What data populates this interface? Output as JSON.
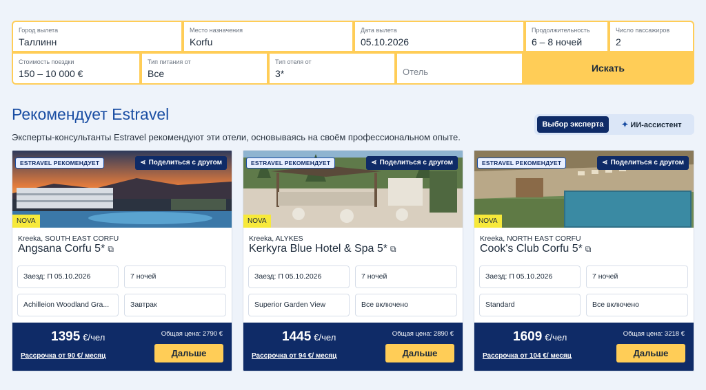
{
  "search": {
    "departure": {
      "label": "Город вылета",
      "value": "Таллинн"
    },
    "destination": {
      "label": "Место назначения",
      "value": "Korfu"
    },
    "date": {
      "label": "Дата вылета",
      "value": "05.10.2026"
    },
    "duration": {
      "label": "Продолжительность",
      "value": "6 – 8 ночей"
    },
    "passengers": {
      "label": "Число пассажиров",
      "value": "2"
    },
    "price": {
      "label": "Стоимость поездки",
      "value": "150 – 10 000 €"
    },
    "meal": {
      "label": "Тип питания от",
      "value": "Все"
    },
    "hotel_type": {
      "label": "Тип отеля от",
      "value": "3*"
    },
    "hotel_placeholder": "Отель",
    "search_button": "Искать"
  },
  "section": {
    "title": "Рекомендует Estravel",
    "subtitle": "Эксперты-консультанты Estravel рекомендуют эти отели, основываясь на своём профессиональном опыте.",
    "toggle_expert": "Выбор эксперта",
    "toggle_ai": "ИИ-ассистент"
  },
  "labels": {
    "recommend_badge": "ESTRAVEL РЕКОМЕНДУЕТ",
    "share": "Поделиться с другом",
    "nova": "NOVA",
    "per_person": "€/чел",
    "next": "Дальше"
  },
  "colors": {
    "accent": "#ffcd57",
    "navy": "#0f2b67",
    "brand_blue": "#1a4ea3",
    "nova": "#f7e93a"
  },
  "cards": [
    {
      "region": "Kreeka, SOUTH EAST CORFU",
      "hotel": "Angsana Corfu 5*",
      "checkin": "Заезд: П 05.10.2026",
      "nights": "7 ночей",
      "room": "Achilleion Woodland Gra...",
      "meal": "Завтрак",
      "price": "1395",
      "total": "Общая цена: 2790 €",
      "installment": "Рассрочка от 90 €/ месяц"
    },
    {
      "region": "Kreeka, ALYKES",
      "hotel": "Kerkyra Blue Hotel & Spa 5*",
      "checkin": "Заезд: П 05.10.2026",
      "nights": "7 ночей",
      "room": "Superior Garden View",
      "meal": "Все включено",
      "price": "1445",
      "total": "Общая цена: 2890 €",
      "installment": "Рассрочка от 94 €/ месяц"
    },
    {
      "region": "Kreeka, NORTH EAST CORFU",
      "hotel": "Cook's Club Corfu 5*",
      "checkin": "Заезд: П 05.10.2026",
      "nights": "7 ночей",
      "room": "Standard",
      "meal": "Все включено",
      "price": "1609",
      "total": "Общая цена: 3218 €",
      "installment": "Рассрочка от 104 €/ месяц"
    }
  ]
}
